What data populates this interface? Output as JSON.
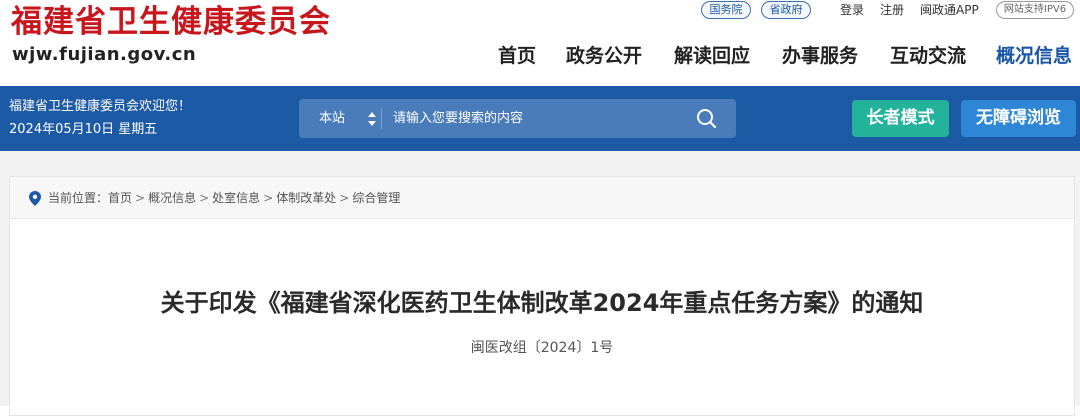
{
  "header": {
    "logo_cn": "福建省卫生健康委员会",
    "logo_en": "wjw.fujian.gov.cn",
    "top_pills": [
      "国务院",
      "省政府"
    ],
    "top_links": [
      "登录",
      "注册",
      "闽政通APP"
    ],
    "ipv6": "网站支持IPV6",
    "nav": [
      "首页",
      "政务公开",
      "解读回应",
      "办事服务",
      "互动交流",
      "概况信息"
    ],
    "active_nav": "概况信息"
  },
  "bar": {
    "welcome": "福建省卫生健康委员会欢迎您！",
    "date": "2024年05月10日 星期五",
    "search_scope": "本站",
    "search_placeholder": "请输入您要搜索的内容",
    "elder_mode": "长者模式",
    "accessible": "无障碍浏览"
  },
  "breadcrumb": {
    "prefix": "当前位置：",
    "items": [
      "首页",
      "概况信息",
      "处室信息",
      "体制改革处",
      "综合管理"
    ],
    "separator": ">"
  },
  "article": {
    "title": "关于印发《福建省深化医药卫生体制改革2024年重点任务方案》的通知",
    "doc_number": "闽医改组〔2024〕1号"
  },
  "colors": {
    "brand_red": "#c8161d",
    "bar_blue": "#1c5aa6",
    "elder_green": "#22b39a",
    "access_blue": "#2e86d6"
  }
}
